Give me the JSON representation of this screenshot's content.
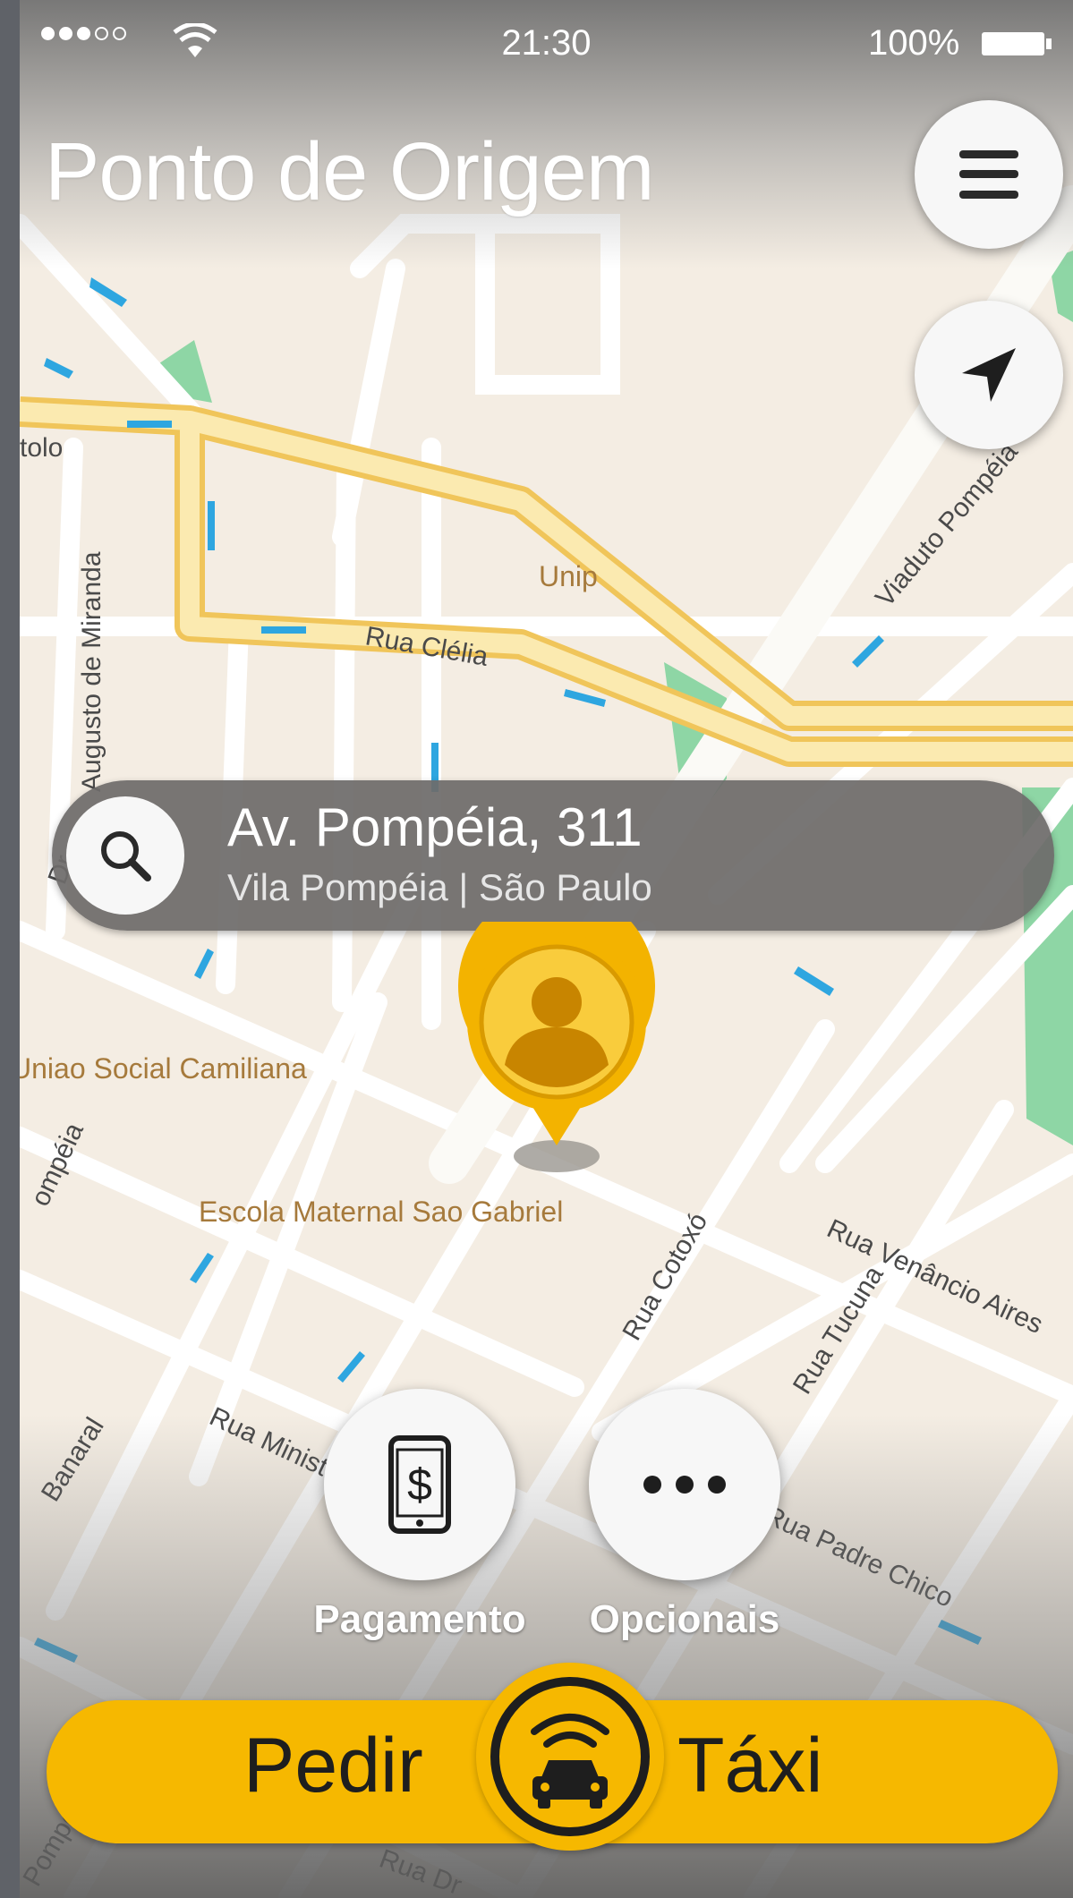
{
  "status_bar": {
    "signal_filled": 3,
    "signal_total": 5,
    "time": "21:30",
    "battery": "100%"
  },
  "header": {
    "title": "Ponto de Origem"
  },
  "icons": {
    "menu": "hamburger-menu-icon",
    "locate": "location-arrow-icon",
    "search": "magnifier-icon",
    "payment": "phone-dollar-icon",
    "options": "ellipsis-icon",
    "taxi": "taxi-signal-icon",
    "pin": "user-location-pin-icon"
  },
  "map": {
    "streets": [
      "Rua Clélia",
      "Viaduto Pompéia",
      "Rua Cotoxó",
      "Rua Venâncio Aires",
      "Rua Tucuna",
      "Rua Ministro",
      "Augusto de Miranda",
      "Rua Padre Chico",
      "Banaral",
      "tolo",
      "Dr.",
      "ompéia",
      "Rua Dr",
      "Pompéia"
    ],
    "places": [
      "Unip",
      "Uniao Social Camiliana",
      "Escola Maternal Sao Gabriel"
    ]
  },
  "search": {
    "address": "Av. Pompéia, 311",
    "subtitle": "Vila Pompéia | São Paulo"
  },
  "actions": {
    "payment_label": "Pagamento",
    "options_label": "Opcionais"
  },
  "request": {
    "left_label": "Pedir",
    "right_label": "Táxi"
  },
  "colors": {
    "accent": "#f6b800",
    "map_background": "#f4ede3",
    "major_road": "#f3d77c",
    "park": "#8ed6a5",
    "arrow": "#2ea6e0"
  }
}
